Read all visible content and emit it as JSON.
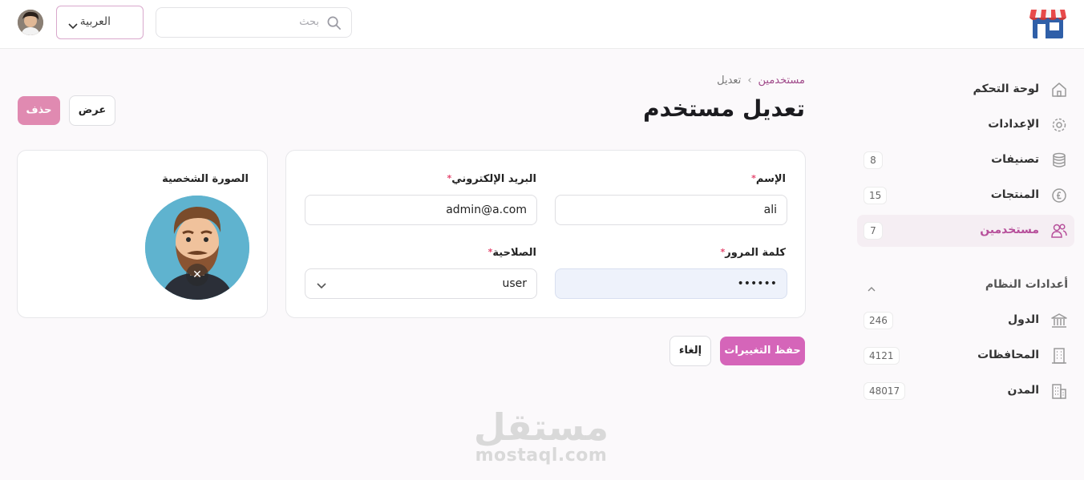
{
  "header": {
    "search_placeholder": "بحث",
    "language": "العربية"
  },
  "sidebar": {
    "items": [
      {
        "label": "لوحة التحكم",
        "icon": "home-icon"
      },
      {
        "label": "الإعدادات",
        "icon": "gear-icon"
      },
      {
        "label": "تصنيفات",
        "icon": "database-icon",
        "count": "8"
      },
      {
        "label": "المنتجات",
        "icon": "currency-icon",
        "count": "15"
      },
      {
        "label": "مستخدمين",
        "icon": "users-icon",
        "count": "7",
        "active": true
      }
    ],
    "group_title": "أعدادات النظام",
    "group_items": [
      {
        "label": "الدول",
        "icon": "bank-icon",
        "count": "246"
      },
      {
        "label": "المحافظات",
        "icon": "building-icon",
        "count": "4121"
      },
      {
        "label": "المدن",
        "icon": "buildings-icon",
        "count": "48017"
      }
    ]
  },
  "breadcrumb": {
    "parent": "مستخدمين",
    "current": "تعديل"
  },
  "page": {
    "title": "تعديل مستخدم",
    "view_label": "عرض",
    "delete_label": "حذف"
  },
  "form": {
    "name_label": "الإسم",
    "name_value": "ali",
    "email_label": "البريد الإلكتروني",
    "email_value": "admin@a.com",
    "password_label": "كلمة المرور",
    "password_value": "••••••",
    "role_label": "الصلاحية",
    "role_value": "user",
    "required_mark": "*"
  },
  "photo": {
    "label": "الصورة الشخصية",
    "remove_symbol": "✕"
  },
  "actions": {
    "save_label": "حفظ التغييرات",
    "cancel_label": "إلغاء"
  },
  "watermark": {
    "arabic": "مستقل",
    "latin": "mostaql.com"
  },
  "colors": {
    "accent": "#d565b9",
    "accent_light": "#e08ab1",
    "active_bg": "#f5eef3",
    "required": "#e5486f"
  }
}
